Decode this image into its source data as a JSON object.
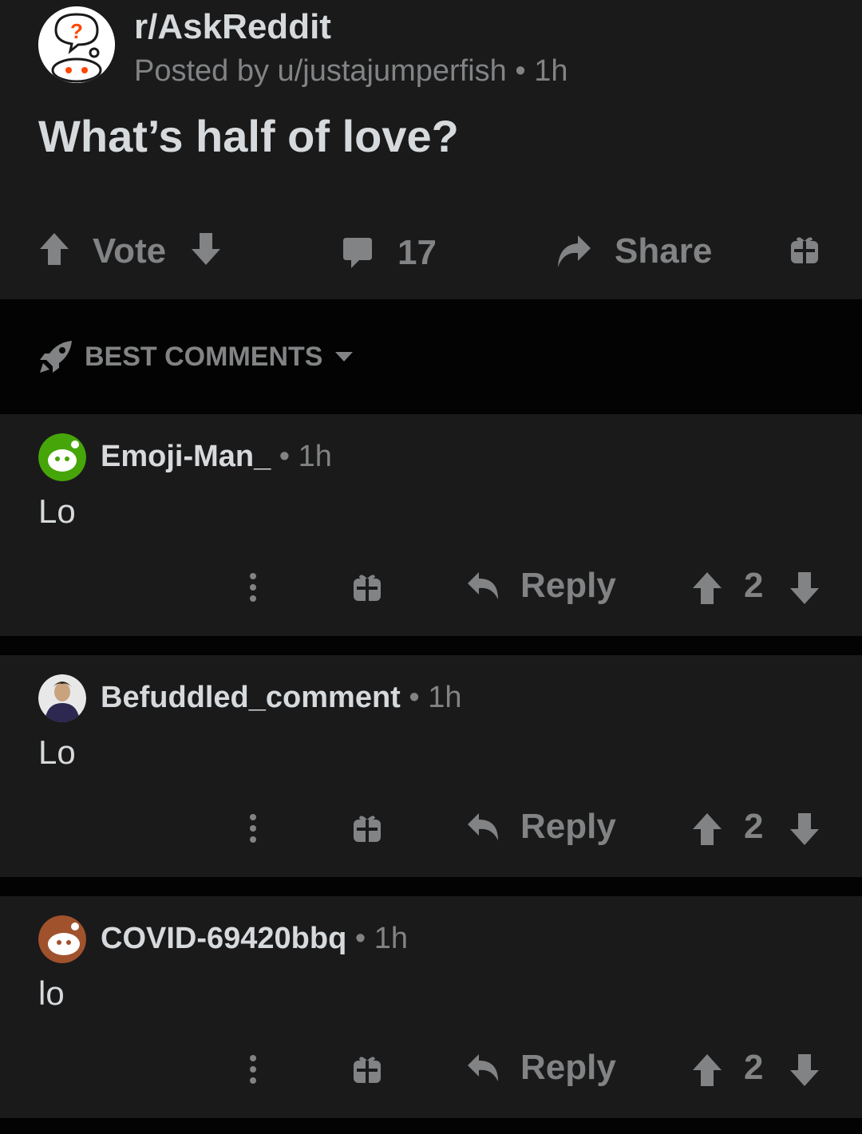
{
  "post": {
    "subreddit": "r/AskReddit",
    "posted_by": "Posted by u/justajumperfish • 1h",
    "title": "What’s half of love?",
    "vote_label": "Vote",
    "comment_count": "17",
    "share_label": "Share"
  },
  "sort": {
    "label": "BEST COMMENTS"
  },
  "comments": [
    {
      "author": "Emoji-Man_",
      "meta": " • 1h",
      "body": "Lo",
      "reply_label": "Reply",
      "score": "2"
    },
    {
      "author": "Befuddled_comment",
      "meta": " • 1h",
      "body": "Lo",
      "reply_label": "Reply",
      "score": "2"
    },
    {
      "author": "COVID-69420bbq",
      "meta": " • 1h",
      "body": "lo",
      "reply_label": "Reply",
      "score": "2"
    }
  ],
  "colors": {
    "card": "#1a1a1b",
    "background": "#030303",
    "text": "#d7dadc",
    "muted": "#818384",
    "accent_red": "#ff4500"
  }
}
